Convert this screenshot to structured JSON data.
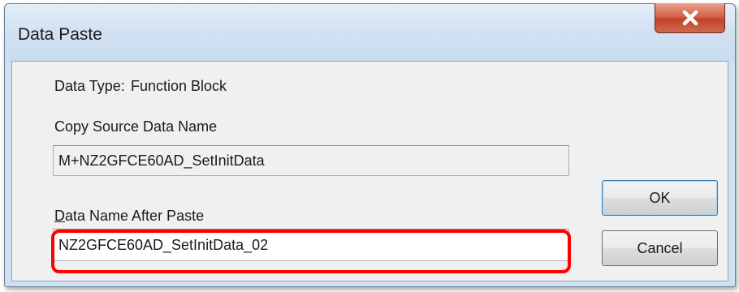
{
  "window": {
    "title": "Data Paste",
    "close_label": "x"
  },
  "form": {
    "data_type_label": "Data Type:",
    "data_type_value": "Function Block",
    "copy_source_label": "Copy Source Data Name",
    "copy_source_value": "M+NZ2GFCE60AD_SetInitData",
    "after_paste_label_mnemonic": "D",
    "after_paste_label_rest": "ata Name After Paste",
    "after_paste_value": "NZ2GFCE60AD_SetInitData_02"
  },
  "buttons": {
    "ok_label": "OK",
    "cancel_label": "Cancel"
  },
  "colors": {
    "highlight": "#ff0000",
    "close_button": "#c7432a"
  }
}
